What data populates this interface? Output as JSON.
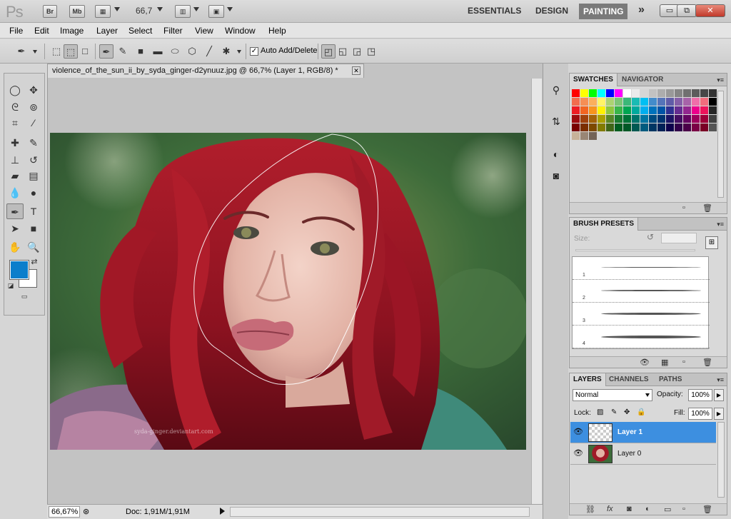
{
  "app": {
    "bridge_label": "Br",
    "minibridge_label": "Mb",
    "zoom_value": "66,7",
    "workspaces": [
      "ESSENTIALS",
      "DESIGN",
      "PAINTING"
    ],
    "more_label": "»",
    "window_min": "▭",
    "window_restore": "⧉",
    "window_close": "✕"
  },
  "menu": [
    "File",
    "Edit",
    "Image",
    "Layer",
    "Select",
    "Filter",
    "View",
    "Window",
    "Help"
  ],
  "options": {
    "auto_add_delete": "Auto Add/Delete",
    "auto_add_delete_checked": "✓"
  },
  "document": {
    "tab_title": "violence_of_the_sun_ii_by_syda_ginger-d2ynuuz.jpg @ 66,7% (Layer 1, RGB/8) *",
    "tab_close": "✕",
    "watermark": "syda-ginger.deviantart.com",
    "status_zoom": "66,67%",
    "status_doc": "Doc: 1,91M/1,91M"
  },
  "colors": {
    "foreground": "#0b7ecb",
    "background": "#ffffff",
    "layer_selected": "#3d8fe0"
  },
  "swatches": {
    "tabs": [
      "SWATCHES",
      "NAVIGATOR"
    ]
  },
  "brushes": {
    "tab": "BRUSH PRESETS",
    "size_label": "Size:",
    "items": [
      "1",
      "2",
      "3",
      "4"
    ]
  },
  "layers": {
    "tabs": [
      "LAYERS",
      "CHANNELS",
      "PATHS"
    ],
    "blend_mode": "Normal",
    "opacity_label": "Opacity:",
    "opacity_value": "100%",
    "lock_label": "Lock:",
    "fill_label": "Fill:",
    "fill_value": "100%",
    "items": [
      {
        "name": "Layer 1",
        "selected": true
      },
      {
        "name": "Layer 0",
        "selected": false
      }
    ]
  }
}
